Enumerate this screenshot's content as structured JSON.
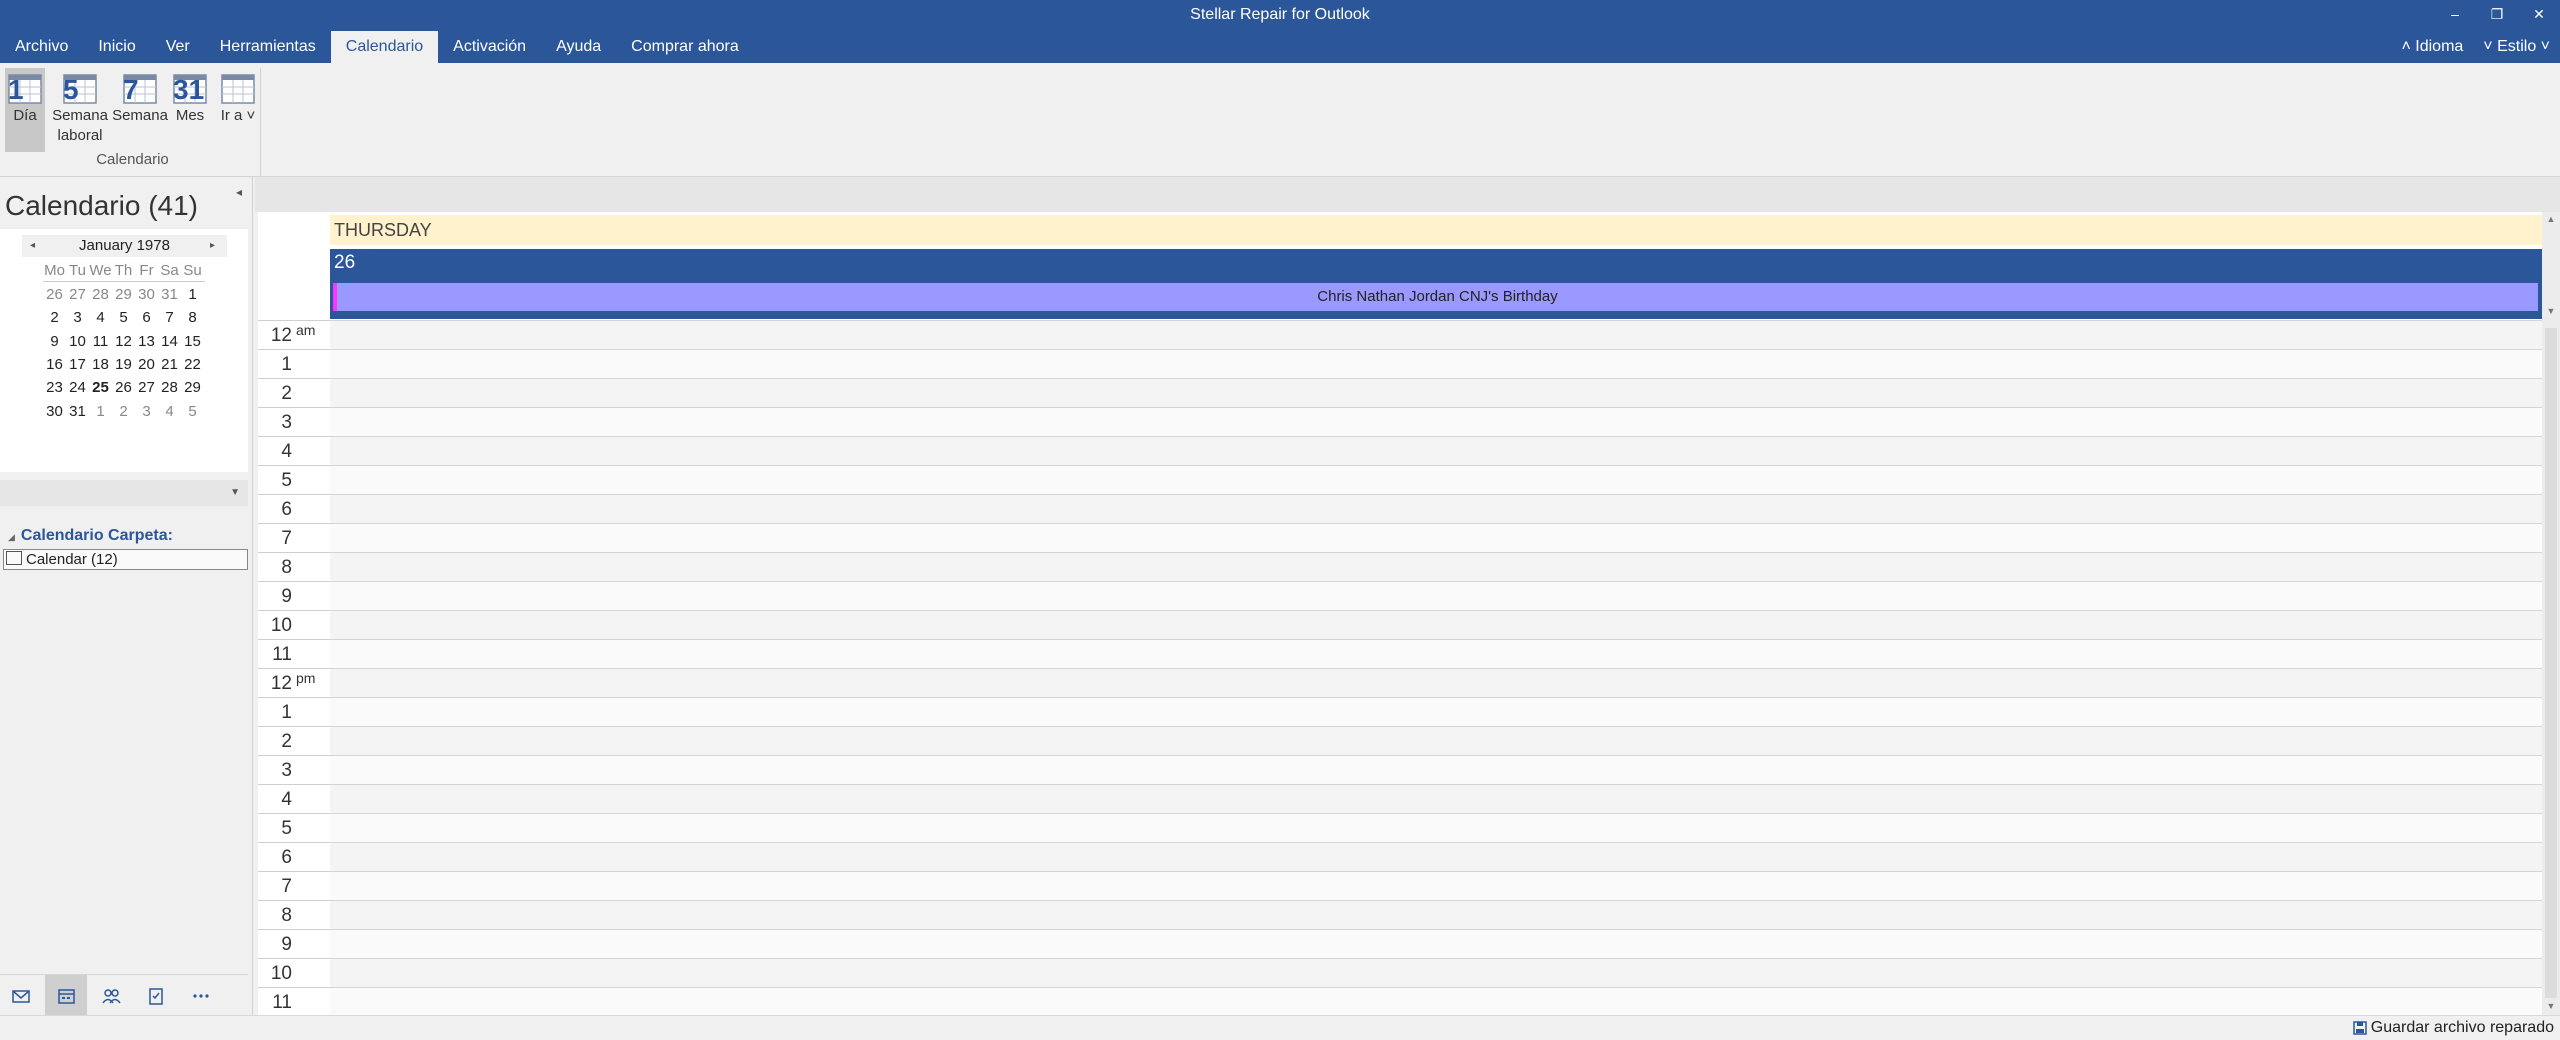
{
  "window": {
    "title": "Stellar Repair for Outlook",
    "controls": {
      "minimize": "–",
      "restore": "❐",
      "close": "✕"
    }
  },
  "menu": {
    "tabs": [
      "Archivo",
      "Inicio",
      "Ver",
      "Herramientas",
      "Calendario",
      "Activación",
      "Ayuda",
      "Comprar ahora"
    ],
    "active_tab": "Calendario",
    "right": {
      "idioma": "˄ Idioma",
      "estilo": "˅ Estilo ˅"
    }
  },
  "ribbon": {
    "group_label": "Calendario",
    "buttons": [
      {
        "label": "Día",
        "icon": "day-view-icon",
        "number": "1"
      },
      {
        "label": "Semana laboral",
        "icon": "work-week-view-icon",
        "number": "5"
      },
      {
        "label": "Semana",
        "icon": "week-view-icon",
        "number": "7"
      },
      {
        "label": "Mes",
        "icon": "month-view-icon",
        "number": "31"
      },
      {
        "label": "Ir a ˅",
        "icon": "goto-icon",
        "number": ""
      }
    ]
  },
  "left_pane": {
    "title": "Calendario (41)",
    "collapse": "◂",
    "mini_calendar": {
      "month_label": "January 1978",
      "prev": "◂",
      "next": "▸",
      "weekdays": [
        "Mo",
        "Tu",
        "We",
        "Th",
        "Fr",
        "Sa",
        "Su"
      ],
      "weeks": [
        [
          "26",
          "27",
          "28",
          "29",
          "30",
          "31",
          "1"
        ],
        [
          "2",
          "3",
          "4",
          "5",
          "6",
          "7",
          "8"
        ],
        [
          "9",
          "10",
          "11",
          "12",
          "13",
          "14",
          "15"
        ],
        [
          "16",
          "17",
          "18",
          "19",
          "20",
          "21",
          "22"
        ],
        [
          "23",
          "24",
          "25",
          "26",
          "27",
          "28",
          "29"
        ],
        [
          "30",
          "31",
          "1",
          "2",
          "3",
          "4",
          "5"
        ]
      ],
      "selected_day": "26"
    },
    "folder_header": "Calendario Carpeta:",
    "folders": [
      {
        "label": "Calendar (12)"
      }
    ],
    "nav_icons": [
      "mail-icon",
      "calendar-icon",
      "people-icon",
      "tasks-icon",
      "more-icon"
    ]
  },
  "day_view": {
    "weekday": "THURSDAY",
    "date_number": "26",
    "all_day_event": "Chris Nathan Jordan CNJ's Birthday",
    "hours": [
      {
        "h": "12",
        "suffix": "am"
      },
      {
        "h": "1",
        "suffix": ""
      },
      {
        "h": "2",
        "suffix": ""
      },
      {
        "h": "3",
        "suffix": ""
      },
      {
        "h": "4",
        "suffix": ""
      },
      {
        "h": "5",
        "suffix": ""
      },
      {
        "h": "6",
        "suffix": ""
      },
      {
        "h": "7",
        "suffix": ""
      },
      {
        "h": "8",
        "suffix": ""
      },
      {
        "h": "9",
        "suffix": ""
      },
      {
        "h": "10",
        "suffix": ""
      },
      {
        "h": "11",
        "suffix": ""
      },
      {
        "h": "12",
        "suffix": "pm"
      },
      {
        "h": "1",
        "suffix": ""
      },
      {
        "h": "2",
        "suffix": ""
      },
      {
        "h": "3",
        "suffix": ""
      },
      {
        "h": "4",
        "suffix": ""
      },
      {
        "h": "5",
        "suffix": ""
      },
      {
        "h": "6",
        "suffix": ""
      },
      {
        "h": "7",
        "suffix": ""
      },
      {
        "h": "8",
        "suffix": ""
      },
      {
        "h": "9",
        "suffix": ""
      },
      {
        "h": "10",
        "suffix": ""
      },
      {
        "h": "11",
        "suffix": ""
      }
    ]
  },
  "status": {
    "save_label": "Guardar archivo reparado"
  },
  "colors": {
    "brand": "#2b579a",
    "weekday_bar": "#fff2cc",
    "event": "#9999ff",
    "event_accent": "#ff33ff"
  }
}
